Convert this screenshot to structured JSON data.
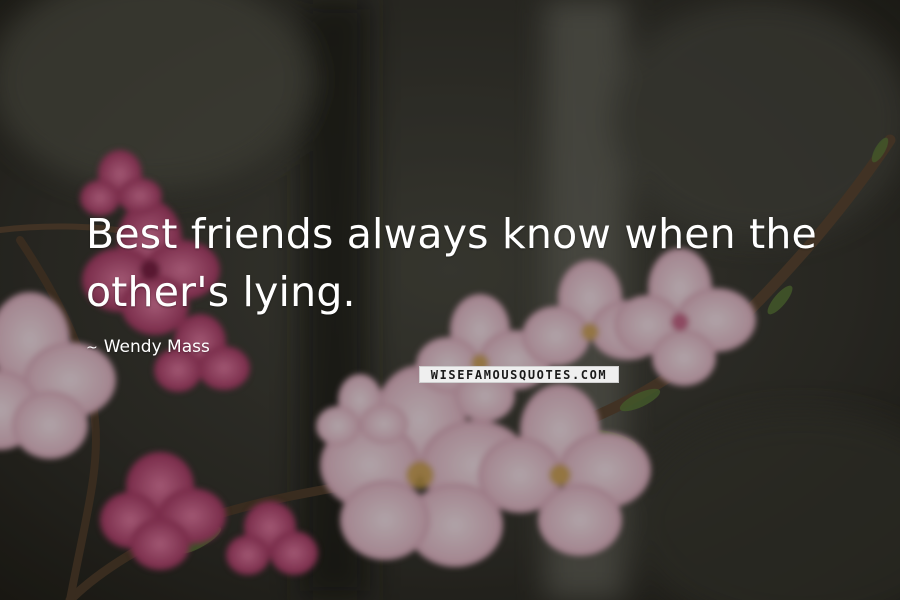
{
  "quote": {
    "line_1": "Best friends always know when the",
    "line_2": "other's lying."
  },
  "author": {
    "prefix": "~",
    "name": "Wendy Mass"
  },
  "watermark": {
    "text": "WISEFAMOUSQUOTES.COM"
  },
  "background": {
    "subject": "pink blossom branch",
    "colors": {
      "base": "#2f2e28",
      "petal": "#e9c7d2",
      "petal_deep": "#b8466e",
      "branch": "#5a4632",
      "leaf": "#5d7a3a"
    }
  }
}
